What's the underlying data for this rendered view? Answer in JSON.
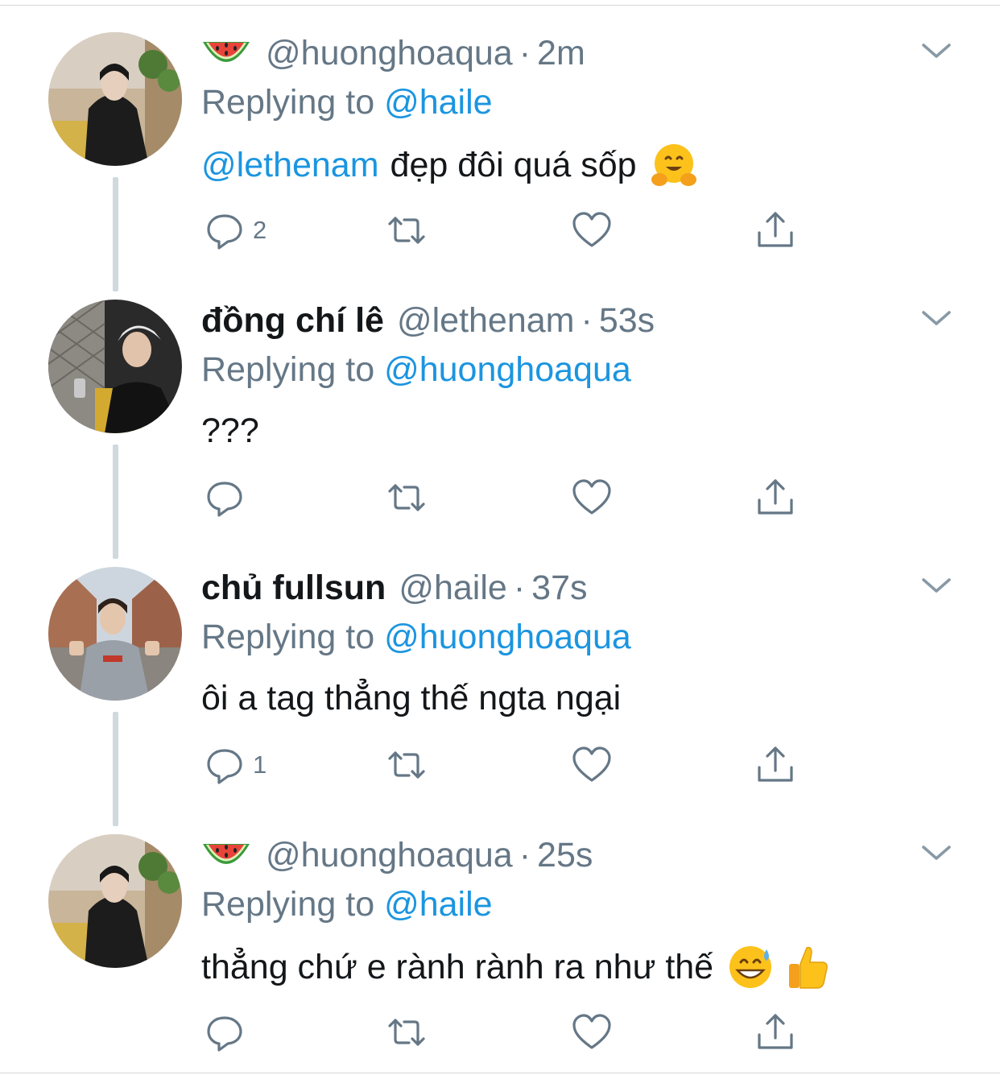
{
  "colors": {
    "text": "#14171a",
    "secondary": "#657786",
    "link": "#1b95e0",
    "thread_line": "#cfd9de"
  },
  "tweets": [
    {
      "name": "",
      "name_emoji": "watermelon",
      "handle": "@huonghoaqua",
      "dot": "·",
      "time": "2m",
      "replying_prefix": "Replying to ",
      "replying_to": "@haile",
      "mention": "@lethenam",
      "text": "đẹp đôi quá sốp",
      "emojis": [
        "hugging-face"
      ],
      "reply_count": "2",
      "avatar": "huonghoaqua-avatar"
    },
    {
      "name": "đồng chí lê",
      "handle": "@lethenam",
      "dot": "·",
      "time": "53s",
      "replying_prefix": "Replying to ",
      "replying_to": "@huonghoaqua",
      "mention": "",
      "text": "???",
      "emojis": [],
      "reply_count": "",
      "avatar": "lethenam-avatar"
    },
    {
      "name": "chủ fullsun",
      "handle": "@haile",
      "dot": "·",
      "time": "37s",
      "replying_prefix": "Replying to ",
      "replying_to": "@huonghoaqua",
      "mention": "",
      "text": "ôi a tag thẳng thế ngta ngại",
      "emojis": [],
      "reply_count": "1",
      "avatar": "haile-avatar"
    },
    {
      "name": "",
      "name_emoji": "watermelon",
      "handle": "@huonghoaqua",
      "dot": "·",
      "time": "25s",
      "replying_prefix": "Replying to ",
      "replying_to": "@haile",
      "mention": "",
      "text": "thẳng chứ e rành rành ra như thế",
      "emojis": [
        "grinning-face-with-sweat",
        "thumbs-up"
      ],
      "reply_count": "",
      "avatar": "huonghoaqua-avatar"
    }
  ]
}
